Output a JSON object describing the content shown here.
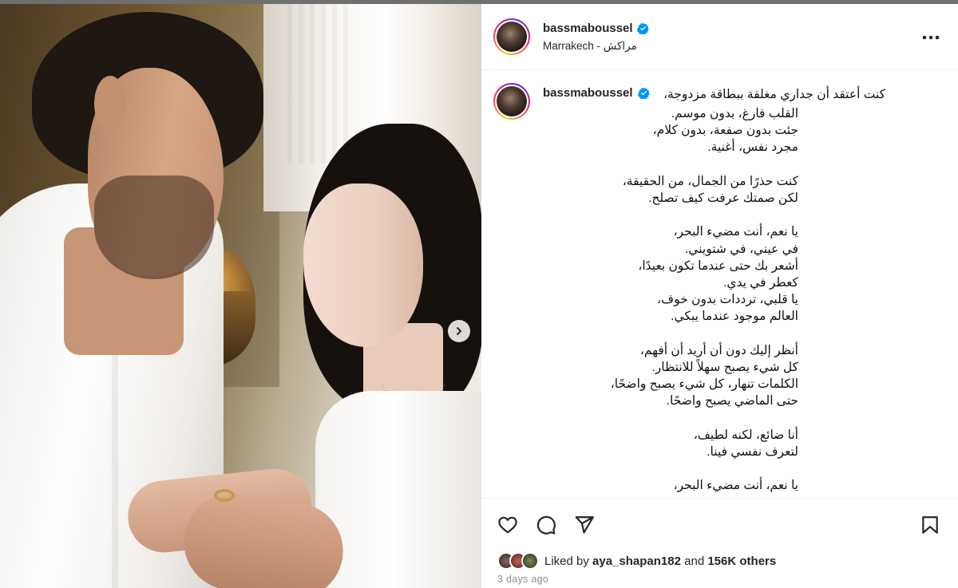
{
  "post": {
    "username": "bassmaboussel",
    "location": "Marrakech - مراكش",
    "caption_first_line": "كنت أعتقد أن جداري مغلقة ببطاقة مزدوجة،",
    "caption_lines": [
      "القلب فارغ، بدون موسم.",
      "جئت بدون صفعة، بدون كلام،",
      "مجرد نفس، أغنية.",
      "",
      "كنت حذرًا من الجمال، من الحقيقة،",
      "لكن صمتك عرفت كيف تصلح.",
      "",
      "يا نعم، أنت مضيء البحر،",
      "في عيني، في شتويني.",
      "أشعر بك حتى عندما تكون بعيدًا،",
      "كعطر في يدي.",
      "يا قلبي، ترددات بدون خوف،",
      "العالم موجود عندما يبكي.",
      "",
      "أنظر إليك دون أن أريد أن أفهم،",
      "كل شيء يصبح سهلاً للانتظار.",
      "الكلمات تنهار، كل شيء يصبح واضحًا،",
      "حتى الماضي يصبح واضحًا.",
      "",
      "أنا ضائع، لكنه لطيف،",
      "لتعرف نفسي فينا.",
      "",
      "يا نعم، أنت مضيء البحر،"
    ],
    "liked_by_prefix": "Liked by",
    "liked_by_user": "aya_shapan182",
    "liked_by_and": "and",
    "liked_by_others": "156K others",
    "time_ago": "3 days ago"
  },
  "icons": {
    "verified": "verified-badge-icon",
    "more": "more-options-icon",
    "like": "heart-icon",
    "comment": "comment-bubble-icon",
    "share": "paper-plane-icon",
    "save": "bookmark-icon",
    "next": "chevron-right-icon"
  },
  "colors": {
    "verified_blue": "#0095f6",
    "muted_text": "#8e8e8e",
    "primary_text": "#262626"
  }
}
